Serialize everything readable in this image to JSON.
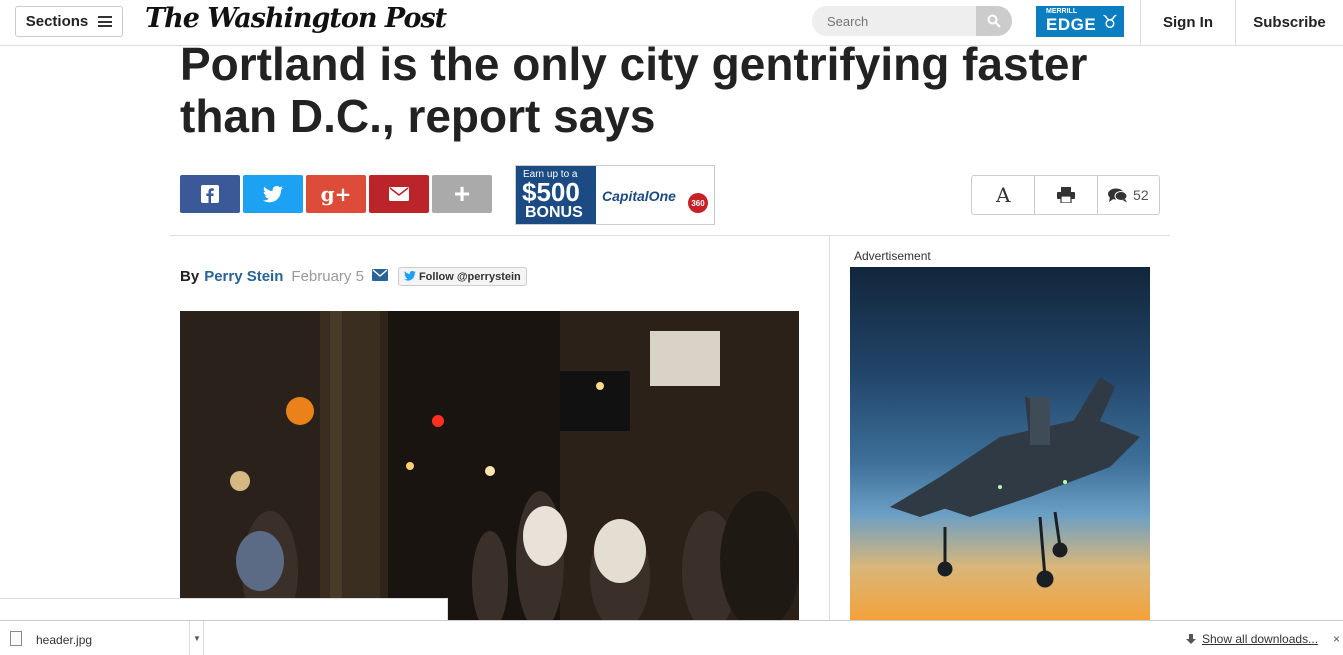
{
  "nav": {
    "sections_label": "Sections",
    "logo_text": "The Washington Post",
    "search_placeholder": "Search",
    "ad_small_line": "MERRILL",
    "ad_main": "EDGE",
    "signin_label": "Sign In",
    "subscribe_label": "Subscribe"
  },
  "article": {
    "headline_line1": "Portland is the only city gentrifying faster",
    "headline_line2": "than D.C., report says",
    "by_label": "By",
    "author": "Perry Stein",
    "date": "February 5",
    "follow_label": "Follow @perrystein"
  },
  "share": {
    "facebook_glyph": "f",
    "twitter_glyph": "t",
    "googleplus_glyph": "g+",
    "email_glyph": "✉",
    "more_glyph": "+"
  },
  "inline_ad": {
    "earn": "Earn up to a",
    "amount": "$500",
    "bonus": "BONUS",
    "brand": "CapitalOne",
    "badge": "360"
  },
  "tools": {
    "font_label": "A",
    "comment_count": "52"
  },
  "sidebar": {
    "ad_label": "Advertisement"
  },
  "downloads": {
    "file_name": "header.jpg",
    "show_all": "Show all downloads...",
    "close": "×"
  },
  "colors": {
    "facebook": "#3b5998",
    "twitter": "#1da1f2",
    "googleplus": "#dd4b39",
    "email": "#bb2428",
    "more": "#aaaaaa",
    "link": "#2a6496"
  }
}
